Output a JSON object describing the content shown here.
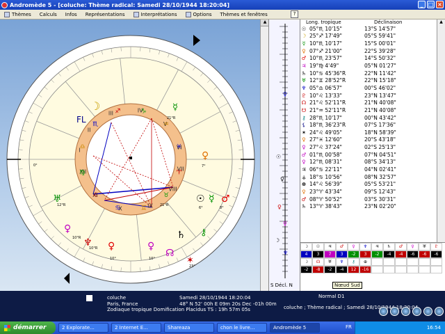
{
  "window": {
    "title": "Andromède 5 - [coluche: Thème radical: Samedi 28/10/1944 18:20:04]"
  },
  "menu": [
    {
      "label": "Thèmes"
    },
    {
      "label": "Calculs"
    },
    {
      "label": "Infos"
    },
    {
      "label": "Représentations"
    },
    {
      "label": "Interprétations"
    },
    {
      "label": "Options"
    },
    {
      "label": "Thèmes et fenêtres"
    }
  ],
  "chart": {
    "house_numerals": [
      "I",
      "II",
      "III",
      "IV",
      "V",
      "VI",
      "VII",
      "VIII",
      "IX",
      "X",
      "XI",
      "XII"
    ],
    "fl_label": "FL",
    "labels": [
      "21°R",
      "12°R",
      "21°R",
      "10°R",
      "10°R",
      "10°",
      "10°",
      "6°",
      "8°",
      "7°",
      "0°",
      "23°"
    ]
  },
  "decl_column": {
    "label": "S Décl. N"
  },
  "table": {
    "header_left": "Long. tropique",
    "header_right": "Déclinaison",
    "rows": [
      {
        "glyph": "☉",
        "color": "#000000",
        "lon": "05°♏ 10'15\"",
        "dec": "13°S 14'57\""
      },
      {
        "glyph": "☽",
        "color": "#c8a000",
        "lon": "25°♐ 17'49\"",
        "dec": "05°S 59'41\""
      },
      {
        "glyph": "☿",
        "color": "#009000",
        "lon": "10°♏ 10'17\"",
        "dec": "15°S 00'01\""
      },
      {
        "glyph": "♀",
        "color": "#e07000",
        "lon": "07°♐ 21'00\"",
        "dec": "22°S 39'28\""
      },
      {
        "glyph": "♂",
        "color": "#e00000",
        "lon": "10°♏ 23'57\"",
        "dec": "14°S 50'32\""
      },
      {
        "glyph": "♃",
        "color": "#c000c0",
        "lon": "19°♍ 4'49\"",
        "dec": "05°N 01'27\""
      },
      {
        "glyph": "♄",
        "color": "#000000",
        "lon": "10°♋ 45'36\"R",
        "dec": "22°N 11'42\""
      },
      {
        "glyph": "♅",
        "color": "#009000",
        "lon": "12°♊ 28'52\"R",
        "dec": "22°N 15'18\""
      },
      {
        "glyph": "♆",
        "color": "#0000c0",
        "lon": "05°♎ 06'57\"",
        "dec": "00°S 46'02\""
      },
      {
        "glyph": "♇",
        "color": "#c80000",
        "lon": "10°♌ 13'33\"",
        "dec": "23°N 13'47\""
      },
      {
        "glyph": "☊",
        "color": "#c80000",
        "lon": "21°♌ 52'11\"R",
        "dec": "21°N 40'08\""
      },
      {
        "glyph": "☋",
        "color": "#c80000",
        "lon": "21°♒ 52'11\"R",
        "dec": "21°N 40'08\""
      },
      {
        "glyph": "⚷",
        "color": "#008080",
        "lon": "28°♏ 10'17\"",
        "dec": "00°N 43'42\""
      },
      {
        "glyph": "⚸",
        "color": "#000080",
        "lon": "18°♏ 36'23\"R",
        "dec": "07°S 17'36\""
      },
      {
        "glyph": "✶",
        "color": "#000000",
        "lon": "24°♌ 49'05\"",
        "dec": "18°N 58'39\""
      },
      {
        "glyph": "♀",
        "color": "#e07000",
        "lon": "27°♓ 12'60\"",
        "dec": "20°S 43'18\""
      },
      {
        "glyph": "♀",
        "color": "#c000c0",
        "lon": "27°♌ 37'24\"",
        "dec": "02°S 25'13\""
      },
      {
        "glyph": "♂",
        "color": "#c000c0",
        "lon": "01°♏ 00'58\"",
        "dec": "07°N 04'51\""
      },
      {
        "glyph": "♀",
        "color": "#c000c0",
        "lon": "12°♏ 08'31\"",
        "dec": "08°S 34'13\""
      },
      {
        "glyph": "♃",
        "color": "#000000",
        "lon": "06°♋ 22'11\"",
        "dec": "04°N 02'41\""
      },
      {
        "glyph": "⚶",
        "color": "#000000",
        "lon": "18°♋ 10'56\"",
        "dec": "08°N 32'57\""
      },
      {
        "glyph": "⊕",
        "color": "#000000",
        "lon": "14°♌ 56'39\"",
        "dec": "05°S 53'21\""
      },
      {
        "glyph": "♀",
        "color": "#e07000",
        "lon": "23°♈ 43'34\"",
        "dec": "09°S 12'43\""
      },
      {
        "glyph": "♂",
        "color": "#c80000",
        "lon": "08°♈ 50'52\"",
        "dec": "03°S 30'31\""
      },
      {
        "glyph": "♄",
        "color": "#000000",
        "lon": "13°♈ 38'43\"",
        "dec": "23°N 02'20\""
      }
    ]
  },
  "aspects": {
    "cells": [
      {
        "t": "☽",
        "bg": "#ffffff",
        "fg": "#000"
      },
      {
        "t": "☉",
        "bg": "#ffffff",
        "fg": "#000"
      },
      {
        "t": "♃",
        "bg": "#ffffff",
        "fg": "#000"
      },
      {
        "t": "♂",
        "bg": "#ffffff",
        "fg": "#c00"
      },
      {
        "t": "♀",
        "bg": "#ffffff",
        "fg": "#c0c"
      },
      {
        "t": "♆",
        "bg": "#ffffff",
        "fg": "#00c"
      },
      {
        "t": "♃",
        "bg": "#ffffff",
        "fg": "#000"
      },
      {
        "t": "♄",
        "bg": "#ffffff",
        "fg": "#000"
      },
      {
        "t": "♂",
        "bg": "#ffffff",
        "fg": "#c00"
      },
      {
        "t": "♀",
        "bg": "#ffffff",
        "fg": "#c0c"
      },
      {
        "t": "♅",
        "bg": "#ffffff",
        "fg": "#000"
      },
      {
        "t": "♇",
        "bg": "#ffffff",
        "fg": "#c00"
      },
      {
        "t": "4",
        "bg": "#0000c0",
        "fg": "#fff"
      },
      {
        "t": "3",
        "bg": "#000000",
        "fg": "#fff"
      },
      {
        "t": "7",
        "bg": "#c000c0",
        "fg": "#fff"
      },
      {
        "t": "3",
        "bg": "#0000c0",
        "fg": "#fff"
      },
      {
        "t": "-2",
        "bg": "#009000",
        "fg": "#fff"
      },
      {
        "t": "3",
        "bg": "#c00000",
        "fg": "#fff"
      },
      {
        "t": "-2",
        "bg": "#009000",
        "fg": "#fff"
      },
      {
        "t": "-4",
        "bg": "#000000",
        "fg": "#fff"
      },
      {
        "t": "-4",
        "bg": "#c00000",
        "fg": "#fff"
      },
      {
        "t": "-6",
        "bg": "#000000",
        "fg": "#fff"
      },
      {
        "t": "-6",
        "bg": "#c00000",
        "fg": "#fff"
      },
      {
        "t": "-6",
        "bg": "#000000",
        "fg": "#fff"
      },
      {
        "t": "☽",
        "bg": "#ffffff",
        "fg": "#000"
      },
      {
        "t": "☊",
        "bg": "#ffffff",
        "fg": "#c00"
      },
      {
        "t": "♅",
        "bg": "#ffffff",
        "fg": "#000"
      },
      {
        "t": "♆",
        "bg": "#ffffff",
        "fg": "#00c"
      },
      {
        "t": "⚷",
        "bg": "#ffffff",
        "fg": "#008080"
      },
      {
        "t": "⊕",
        "bg": "#ffffff",
        "fg": "#000"
      },
      {
        "t": "",
        "bg": "#ffffff",
        "fg": "#000"
      },
      {
        "t": "",
        "bg": "#ffffff",
        "fg": "#000"
      },
      {
        "t": "",
        "bg": "#ffffff",
        "fg": "#000"
      },
      {
        "t": "",
        "bg": "#ffffff",
        "fg": "#000"
      },
      {
        "t": "",
        "bg": "#ffffff",
        "fg": "#000"
      },
      {
        "t": "",
        "bg": "#ffffff",
        "fg": "#000"
      },
      {
        "t": "-2",
        "bg": "#000000",
        "fg": "#fff"
      },
      {
        "t": "-8",
        "bg": "#c00000",
        "fg": "#fff"
      },
      {
        "t": "-2",
        "bg": "#000000",
        "fg": "#fff"
      },
      {
        "t": "-4",
        "bg": "#000000",
        "fg": "#fff"
      },
      {
        "t": "12",
        "bg": "#c00000",
        "fg": "#fff"
      },
      {
        "t": "-16",
        "bg": "#c00000",
        "fg": "#fff"
      },
      {
        "t": "",
        "bg": "#ffffff",
        "fg": "#000"
      },
      {
        "t": "",
        "bg": "#ffffff",
        "fg": "#000"
      },
      {
        "t": "",
        "bg": "#ffffff",
        "fg": "#000"
      },
      {
        "t": "",
        "bg": "#ffffff",
        "fg": "#000"
      },
      {
        "t": "",
        "bg": "#ffffff",
        "fg": "#000"
      },
      {
        "t": "",
        "bg": "#ffffff",
        "fg": "#000"
      }
    ],
    "tooltip": "Nœud Sud"
  },
  "status": {
    "name": "coluche",
    "place": "Paris, France",
    "zodiac": "Zodiaque tropique  Domification  Placidus  TS : 19h 57m 05s",
    "date": "Samedi 28/10/1944 18:20:04",
    "coords": "48° N 52' 00h E 09m 20s Dec -01h 00m",
    "mode": "Normal D1",
    "theme": "coluche ; Thème radical ; Samedi 28/10/1944 18:20:04"
  },
  "taskbar": {
    "start": "démarrer",
    "tasks": [
      "2 Explorate...",
      "2 Internet E...",
      "Shareaza",
      "chon le livre...",
      "Andromède 5"
    ],
    "lang": "FR",
    "clock": "16:54"
  }
}
